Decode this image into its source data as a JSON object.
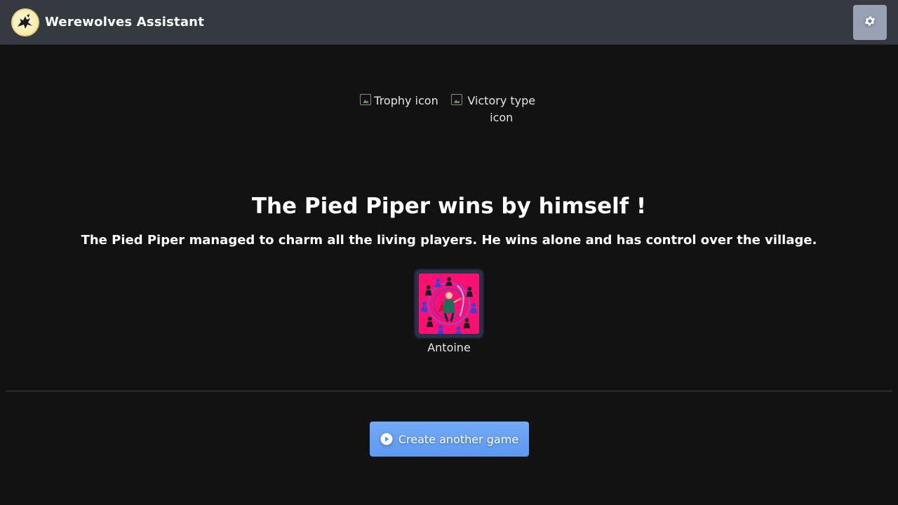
{
  "header": {
    "title": "Werewolves Assistant",
    "logo_icon": "werewolf-logo-icon",
    "settings_icon": "gear-icon"
  },
  "icons": {
    "trophy_alt": "Trophy icon",
    "victory_alt": "Victory type icon"
  },
  "result": {
    "title": "The Pied Piper wins by himself !",
    "description": "The Pied Piper managed to charm all the living players. He wins alone and has control over the village."
  },
  "winners": [
    {
      "name": "Antoine",
      "role_icon": "pied-piper-role-icon"
    }
  ],
  "actions": {
    "create_label": "Create another game",
    "create_icon": "play-circle-icon"
  },
  "colors": {
    "background": "#121212",
    "navbar": "#343a40",
    "settings_button": "#98a2b3",
    "primary_button": "#6aa3f5",
    "role_background": "#ff0f74"
  }
}
